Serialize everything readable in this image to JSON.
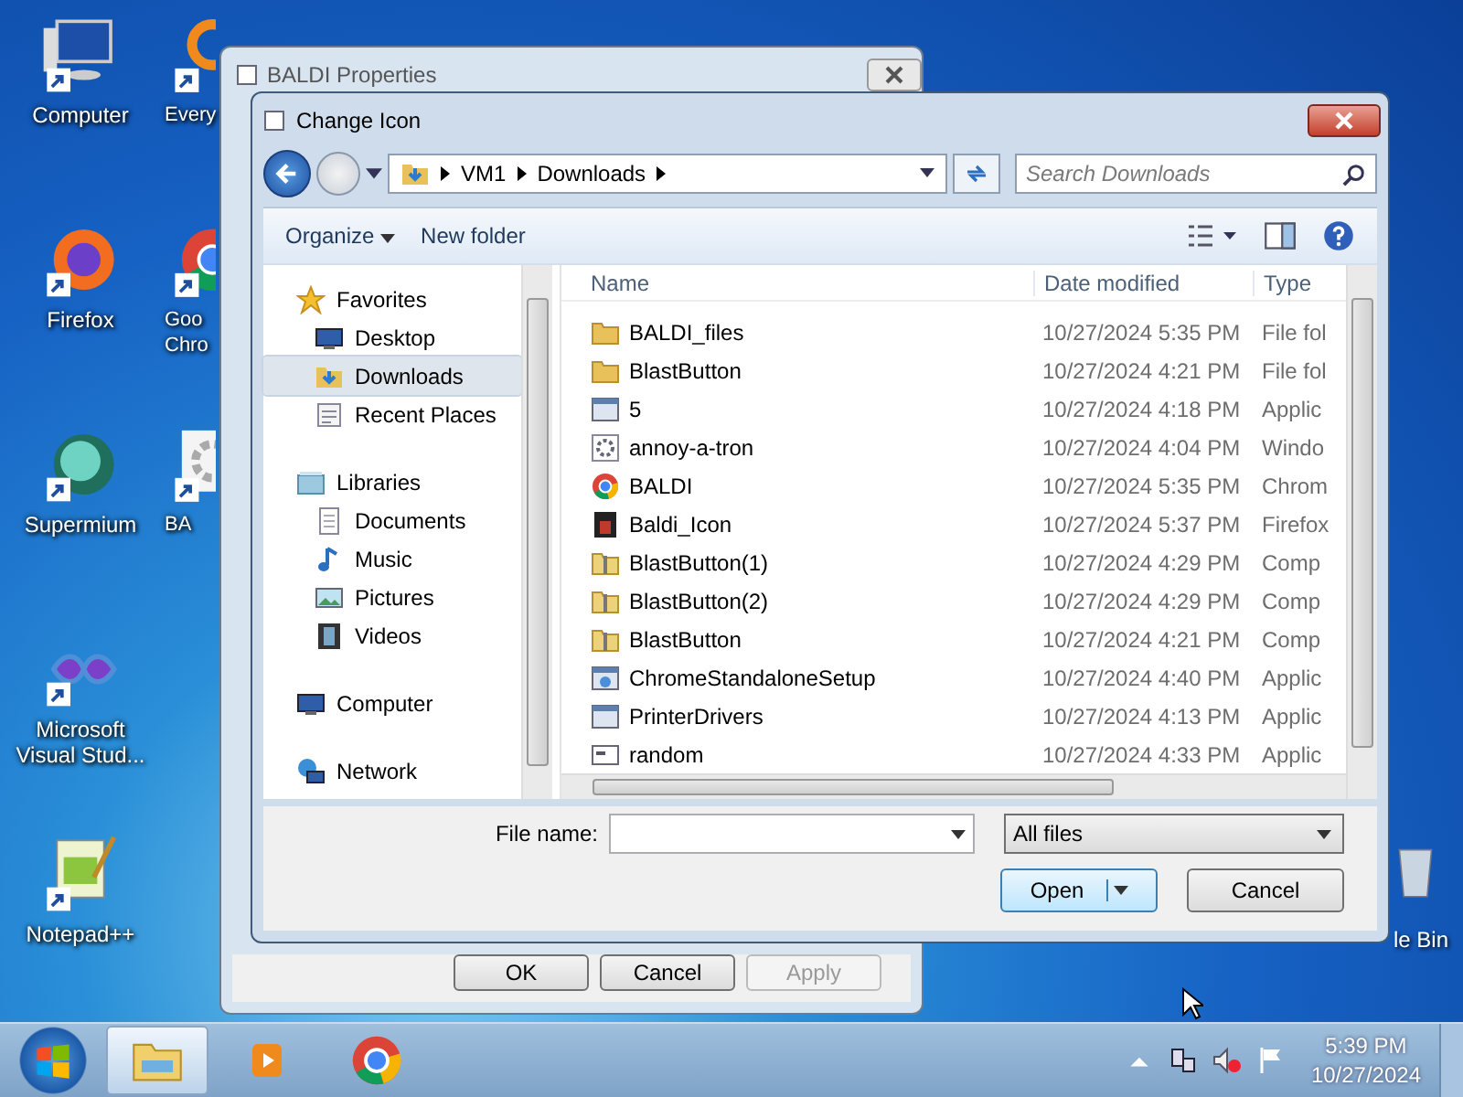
{
  "desktop": {
    "icons": [
      {
        "kind": "computer",
        "lines": [
          "Computer"
        ]
      },
      {
        "kind": "ring",
        "lines": [
          "Every"
        ]
      },
      {
        "kind": "firefox",
        "lines": [
          "Firefox"
        ]
      },
      {
        "kind": "chrome",
        "lines": [
          "Goo",
          "Chro"
        ]
      },
      {
        "kind": "supermium",
        "lines": [
          "Supermium"
        ]
      },
      {
        "kind": "gear",
        "lines": [
          "BA"
        ]
      },
      {
        "kind": "vs",
        "lines": [
          "Microsoft",
          "Visual Stud..."
        ]
      },
      {
        "kind": "notepad",
        "lines": [
          "Notepad++"
        ]
      }
    ],
    "recycle_label": "le Bin"
  },
  "background_window": {
    "title": "BALDI Properties",
    "buttons": [
      {
        "label": "OK",
        "disabled": false
      },
      {
        "label": "Cancel",
        "disabled": false
      },
      {
        "label": "Apply",
        "disabled": true
      }
    ]
  },
  "dialog": {
    "title": "Change Icon",
    "address": {
      "crumbs": [
        "VM1",
        "Downloads"
      ]
    },
    "search": {
      "placeholder": "Search Downloads"
    },
    "toolbar": {
      "organize": "Organize",
      "new_folder": "New folder"
    },
    "navigation": [
      {
        "label": "Favorites",
        "kind": "star",
        "selected": false,
        "children": [
          {
            "label": "Desktop",
            "kind": "desktop",
            "selected": false
          },
          {
            "label": "Downloads",
            "kind": "downloads",
            "selected": true
          },
          {
            "label": "Recent Places",
            "kind": "recent",
            "selected": false
          }
        ]
      },
      {
        "label": "Libraries",
        "kind": "library",
        "selected": false,
        "children": [
          {
            "label": "Documents",
            "kind": "document",
            "selected": false
          },
          {
            "label": "Music",
            "kind": "music",
            "selected": false
          },
          {
            "label": "Pictures",
            "kind": "picture",
            "selected": false
          },
          {
            "label": "Videos",
            "kind": "video",
            "selected": false
          }
        ]
      },
      {
        "label": "Computer",
        "kind": "computer",
        "selected": false
      },
      {
        "label": "Network",
        "kind": "network",
        "selected": false
      }
    ],
    "columns": [
      "Name",
      "Date modified",
      "Type"
    ],
    "files": [
      {
        "name": "BALDI_files",
        "date": "10/27/2024 5:35 PM",
        "type": "File fol",
        "kind": "folder"
      },
      {
        "name": "BlastButton",
        "date": "10/27/2024 4:21 PM",
        "type": "File fol",
        "kind": "folder"
      },
      {
        "name": "5",
        "date": "10/27/2024 4:18 PM",
        "type": "Applic",
        "kind": "app"
      },
      {
        "name": "annoy-a-tron",
        "date": "10/27/2024 4:04 PM",
        "type": "Windo",
        "kind": "settings"
      },
      {
        "name": "BALDI",
        "date": "10/27/2024 5:35 PM",
        "type": "Chrom",
        "kind": "chrome"
      },
      {
        "name": "Baldi_Icon",
        "date": "10/27/2024 5:37 PM",
        "type": "Firefox",
        "kind": "image"
      },
      {
        "name": "BlastButton(1)",
        "date": "10/27/2024 4:29 PM",
        "type": "Comp",
        "kind": "zip"
      },
      {
        "name": "BlastButton(2)",
        "date": "10/27/2024 4:29 PM",
        "type": "Comp",
        "kind": "zip"
      },
      {
        "name": "BlastButton",
        "date": "10/27/2024 4:21 PM",
        "type": "Comp",
        "kind": "zip"
      },
      {
        "name": "ChromeStandaloneSetup",
        "date": "10/27/2024 4:40 PM",
        "type": "Applic",
        "kind": "setup"
      },
      {
        "name": "PrinterDrivers",
        "date": "10/27/2024 4:13 PM",
        "type": "Applic",
        "kind": "app"
      },
      {
        "name": "random",
        "date": "10/27/2024 4:33 PM",
        "type": "Applic",
        "kind": "console"
      }
    ],
    "file_name": {
      "label": "File name:"
    },
    "filter": "All files",
    "buttons": {
      "open": "Open",
      "cancel": "Cancel"
    }
  },
  "taskbar": {
    "items": [
      {
        "kind": "explorer",
        "selected": true
      },
      {
        "kind": "media",
        "selected": false
      },
      {
        "kind": "chrome",
        "selected": false
      }
    ],
    "time": "5:39 PM",
    "date": "10/27/2024"
  }
}
